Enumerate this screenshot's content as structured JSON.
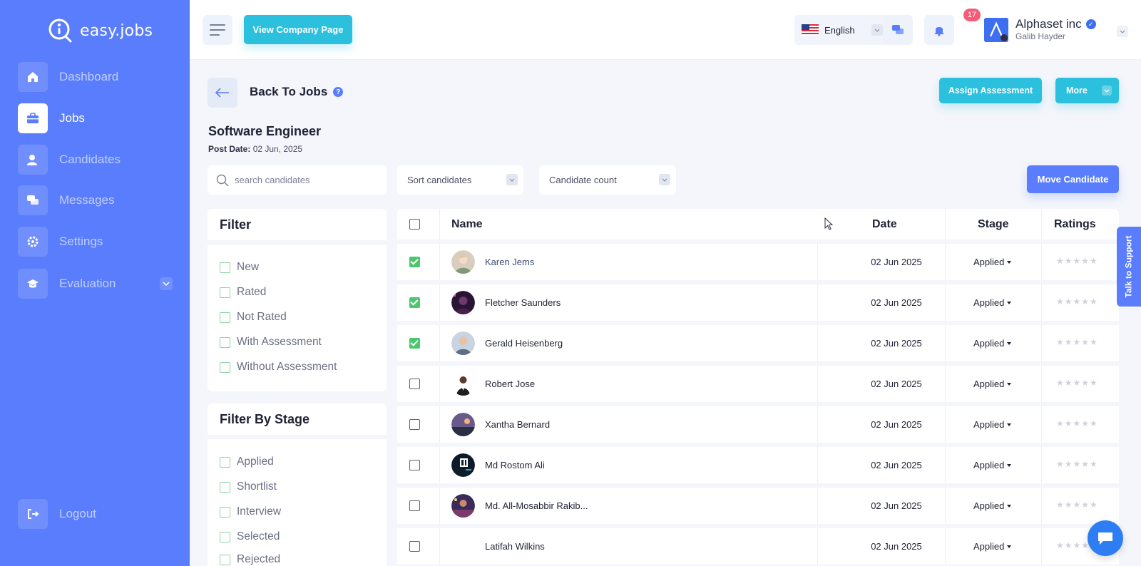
{
  "brand": {
    "name": "easy.jobs"
  },
  "colors": {
    "primary": "#597dfc",
    "accent": "#2bc0de",
    "success": "#4cc76f",
    "danger": "#f65b78"
  },
  "sidebar": {
    "items": [
      {
        "label": "Dashboard",
        "icon": "home-icon",
        "active": false
      },
      {
        "label": "Jobs",
        "icon": "briefcase-icon",
        "active": true
      },
      {
        "label": "Candidates",
        "icon": "user-icon",
        "active": false
      },
      {
        "label": "Messages",
        "icon": "chat-icon",
        "active": false
      },
      {
        "label": "Settings",
        "icon": "gear-icon",
        "active": false
      },
      {
        "label": "Evaluation",
        "icon": "graduation-cap-icon",
        "active": false
      }
    ],
    "logout": "Logout"
  },
  "topbar": {
    "view_company": "View Company Page",
    "language": "English",
    "notification_count": "17",
    "company_name": "Alphaset inc",
    "user_name": "Galib Hayder"
  },
  "header": {
    "back_label": "Back To Jobs",
    "assign_assessment": "Assign Assessment",
    "more": "More",
    "job_title": "Software Engineer",
    "post_date_label": "Post Date:",
    "post_date_value": "02 Jun, 2025"
  },
  "toolbar": {
    "search_placeholder": "search candidates",
    "sort_label": "Sort candidates",
    "count_label": "Candidate count",
    "move_candidate": "Move Candidate"
  },
  "filter": {
    "title": "Filter",
    "items": [
      "New",
      "Rated",
      "Not Rated",
      "With Assessment",
      "Without Assessment"
    ]
  },
  "filter_stage": {
    "title": "Filter By Stage",
    "items": [
      "Applied",
      "Shortlist",
      "Interview",
      "Selected",
      "Rejected"
    ]
  },
  "table": {
    "headers": {
      "name": "Name",
      "date": "Date",
      "stage": "Stage",
      "ratings": "Ratings"
    },
    "rows": [
      {
        "name": "Karen Jems",
        "date": "02 Jun 2025",
        "stage": "Applied",
        "checked": true
      },
      {
        "name": "Fletcher Saunders",
        "date": "02 Jun 2025",
        "stage": "Applied",
        "checked": true
      },
      {
        "name": "Gerald Heisenberg",
        "date": "02 Jun 2025",
        "stage": "Applied",
        "checked": true
      },
      {
        "name": "Robert Jose",
        "date": "02 Jun 2025",
        "stage": "Applied",
        "checked": false
      },
      {
        "name": "Xantha Bernard",
        "date": "02 Jun 2025",
        "stage": "Applied",
        "checked": false
      },
      {
        "name": "Md Rostom Ali",
        "date": "02 Jun 2025",
        "stage": "Applied",
        "checked": false
      },
      {
        "name": "Md. All-Mosabbir Rakib...",
        "date": "02 Jun 2025",
        "stage": "Applied",
        "checked": false
      },
      {
        "name": "Latifah Wilkins",
        "date": "02 Jun 2025",
        "stage": "Applied",
        "checked": false
      }
    ],
    "stars": "★★★★★"
  },
  "support": {
    "label": "Talk to Support"
  }
}
